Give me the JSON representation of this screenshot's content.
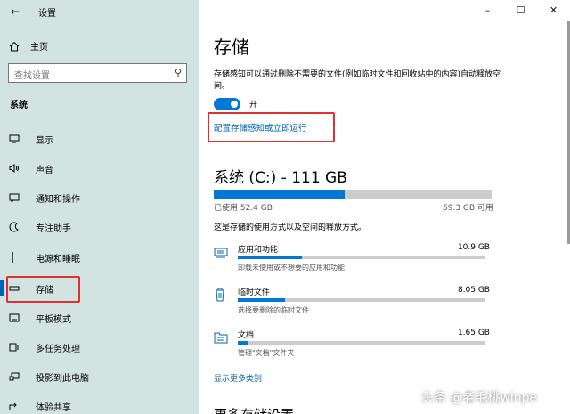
{
  "window": {
    "title": "设置",
    "controls": [
      "–",
      "☐",
      "✕"
    ]
  },
  "sidebar": {
    "home_label": "主页",
    "search_placeholder": "查找设置",
    "section_label": "系统",
    "items": [
      {
        "label": "显示",
        "icon": "display-icon"
      },
      {
        "label": "声音",
        "icon": "sound-icon"
      },
      {
        "label": "通知和操作",
        "icon": "notification-icon"
      },
      {
        "label": "专注助手",
        "icon": "focus-assist-icon"
      },
      {
        "label": "电源和睡眠",
        "icon": "power-icon"
      },
      {
        "label": "存储",
        "icon": "storage-icon",
        "selected": true
      },
      {
        "label": "平板模式",
        "icon": "tablet-icon"
      },
      {
        "label": "多任务处理",
        "icon": "multitask-icon"
      },
      {
        "label": "投影到此电脑",
        "icon": "project-icon"
      },
      {
        "label": "体验共享",
        "icon": "share-icon"
      }
    ]
  },
  "main": {
    "title": "存储",
    "description": "存储感知可以通过删除不需要的文件(例如临时文件和回收站中的内容)自动释放空间。",
    "toggle_label": "开",
    "toggle_on": true,
    "config_link": "配置存储感知或立即运行",
    "drive": {
      "title": "系统 (C:) - 111 GB",
      "used_label": "已使用 52.4 GB",
      "free_label": "59.3 GB 可用",
      "used_fraction": 0.472,
      "description": "这是存储的使用方式以及空间的释放方式。"
    },
    "categories": [
      {
        "name": "应用和功能",
        "size": "10.9 GB",
        "sub": "卸载未使用或不想要的应用和功能",
        "fraction": 0.26,
        "icon": "apps-icon"
      },
      {
        "name": "临时文件",
        "size": "8.05 GB",
        "sub": "选择要删除的临时文件",
        "fraction": 0.19,
        "icon": "trash-icon"
      },
      {
        "name": "文档",
        "size": "1.65 GB",
        "sub": "管理\"文档\"文件夹",
        "fraction": 0.04,
        "icon": "folder-icon"
      }
    ],
    "more_link": "显示更多类别",
    "more_heading": "更多存储设置"
  },
  "watermark": "头条 @老毛桃winpe",
  "colors": {
    "accent": "#0078d7",
    "sidebar_bg": "#d3e3e1",
    "highlight": "#e03030"
  }
}
